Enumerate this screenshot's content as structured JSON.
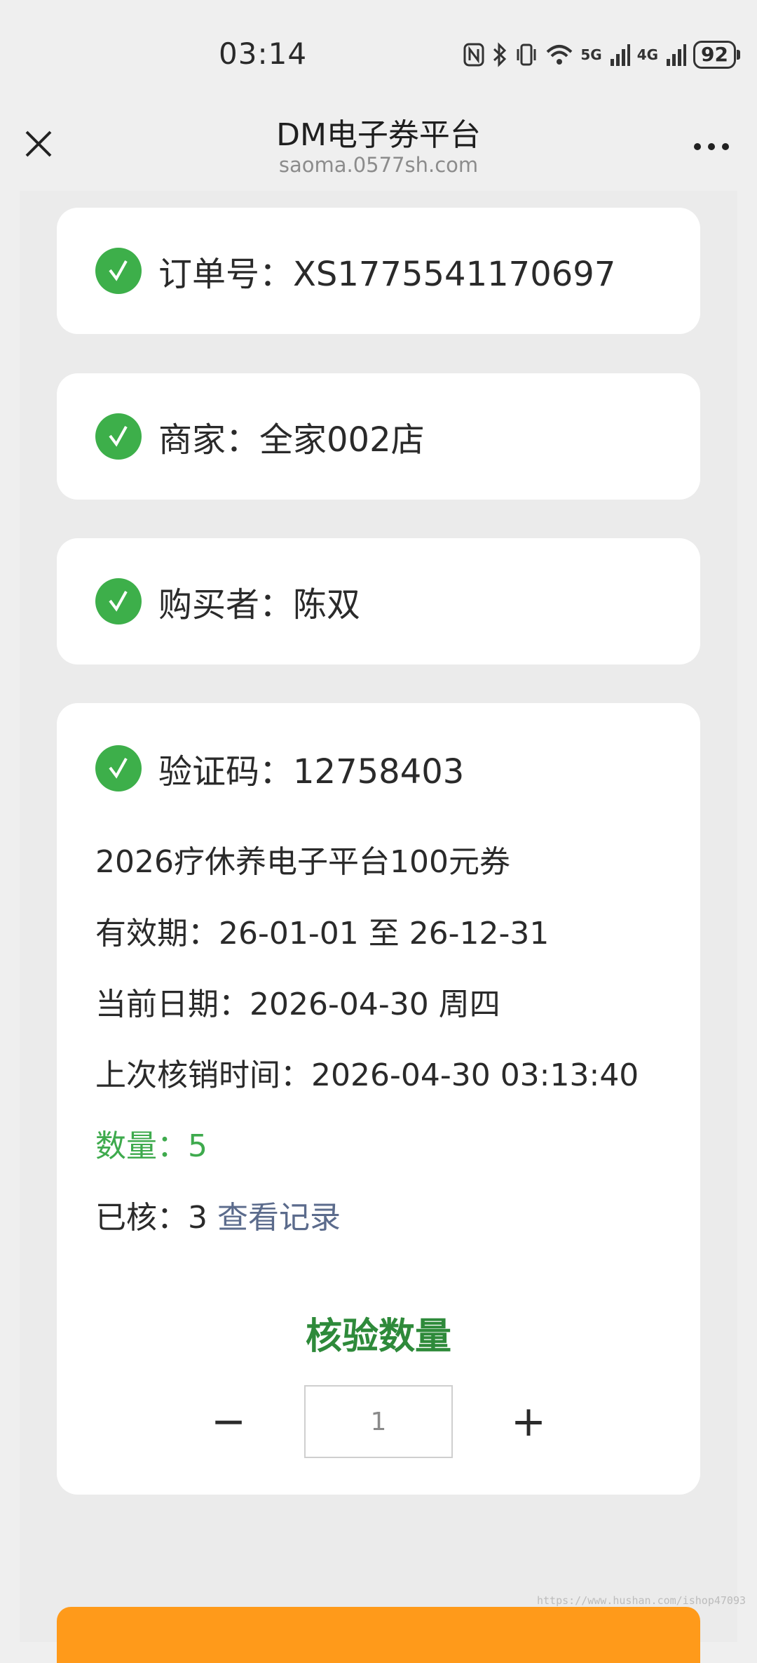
{
  "status_bar": {
    "time": "03:14",
    "battery": "92",
    "net1": "5G",
    "net2": "4G"
  },
  "header": {
    "title": "DM电子券平台",
    "subtitle": "saoma.0577sh.com"
  },
  "cards": {
    "order": "订单号：XS1775541170697",
    "merchant": "商家：全家002店",
    "buyer": "购买者：陈双",
    "code": "验证码：12758403"
  },
  "details": {
    "coupon_name": "2026疗休养电子平台100元券",
    "validity": "有效期：26-01-01 至 26-12-31",
    "current_date": "当前日期：2026-04-30 周四",
    "last_verify": "上次核销时间：2026-04-30 03:13:40",
    "quantity": "数量：5",
    "verified_prefix": "已核：3",
    "view_records": "查看记录"
  },
  "verify": {
    "title": "核验数量",
    "minus": "−",
    "plus": "+",
    "value": "1"
  },
  "watermark": "https://www.hushan.com/ishop47093",
  "colors": {
    "accent_green": "#3daf4a",
    "title_green": "#2e8a3a",
    "link": "#5b6b8c",
    "button_orange": "#ff9a1a"
  }
}
